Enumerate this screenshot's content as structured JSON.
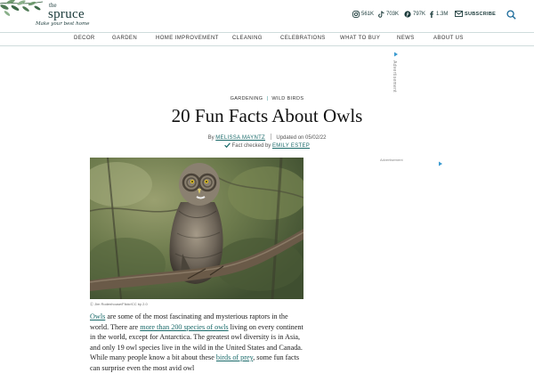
{
  "brand": {
    "the": "the",
    "name": "spruce",
    "tagline": "Make your best home"
  },
  "social": [
    {
      "icon": "instagram-icon",
      "count": "561K"
    },
    {
      "icon": "tiktok-icon",
      "count": "703K"
    },
    {
      "icon": "pinterest-icon",
      "count": "797K"
    },
    {
      "icon": "facebook-icon",
      "count": "1.3M"
    }
  ],
  "subscribe_label": "SUBSCRIBE",
  "nav": [
    "DECOR",
    "GARDEN",
    "HOME IMPROVEMENT",
    "CLEANING",
    "CELEBRATIONS",
    "WHAT TO BUY",
    "NEWS",
    "ABOUT US"
  ],
  "ad_label": "Advertisement",
  "ad_label_small": "Advertisement",
  "breadcrumb": [
    "GARDENING",
    "WILD BIRDS"
  ],
  "article": {
    "title": "20 Fun Facts About Owls",
    "by": "By",
    "author": "MELISSA MAYNTZ",
    "updated": "Updated on 05/02/22",
    "fact_checked_by": "Fact checked by",
    "checker": "EMILY ESTEP",
    "photo_credit": "Jim Rodenhouse/Flickr/CC by 2.0",
    "p_link1": "Owls",
    "p_text1": " are some of the most fascinating and mysterious raptors in the world. There are ",
    "p_link2": "more than 200 species of owls",
    "p_text2": " living on every continent in the world, except for Antarctica. The greatest owl diversity is in Asia, and only 19 owl species live in the wild in the United States and Canada. While many people know a bit about these ",
    "p_link3": "birds of prey",
    "p_text3": ", some fun facts can surprise even the most avid owl"
  },
  "colors": {
    "accent": "#1a6a6a",
    "brand": "#1a3a3a",
    "divider": "#cfdcdc"
  }
}
